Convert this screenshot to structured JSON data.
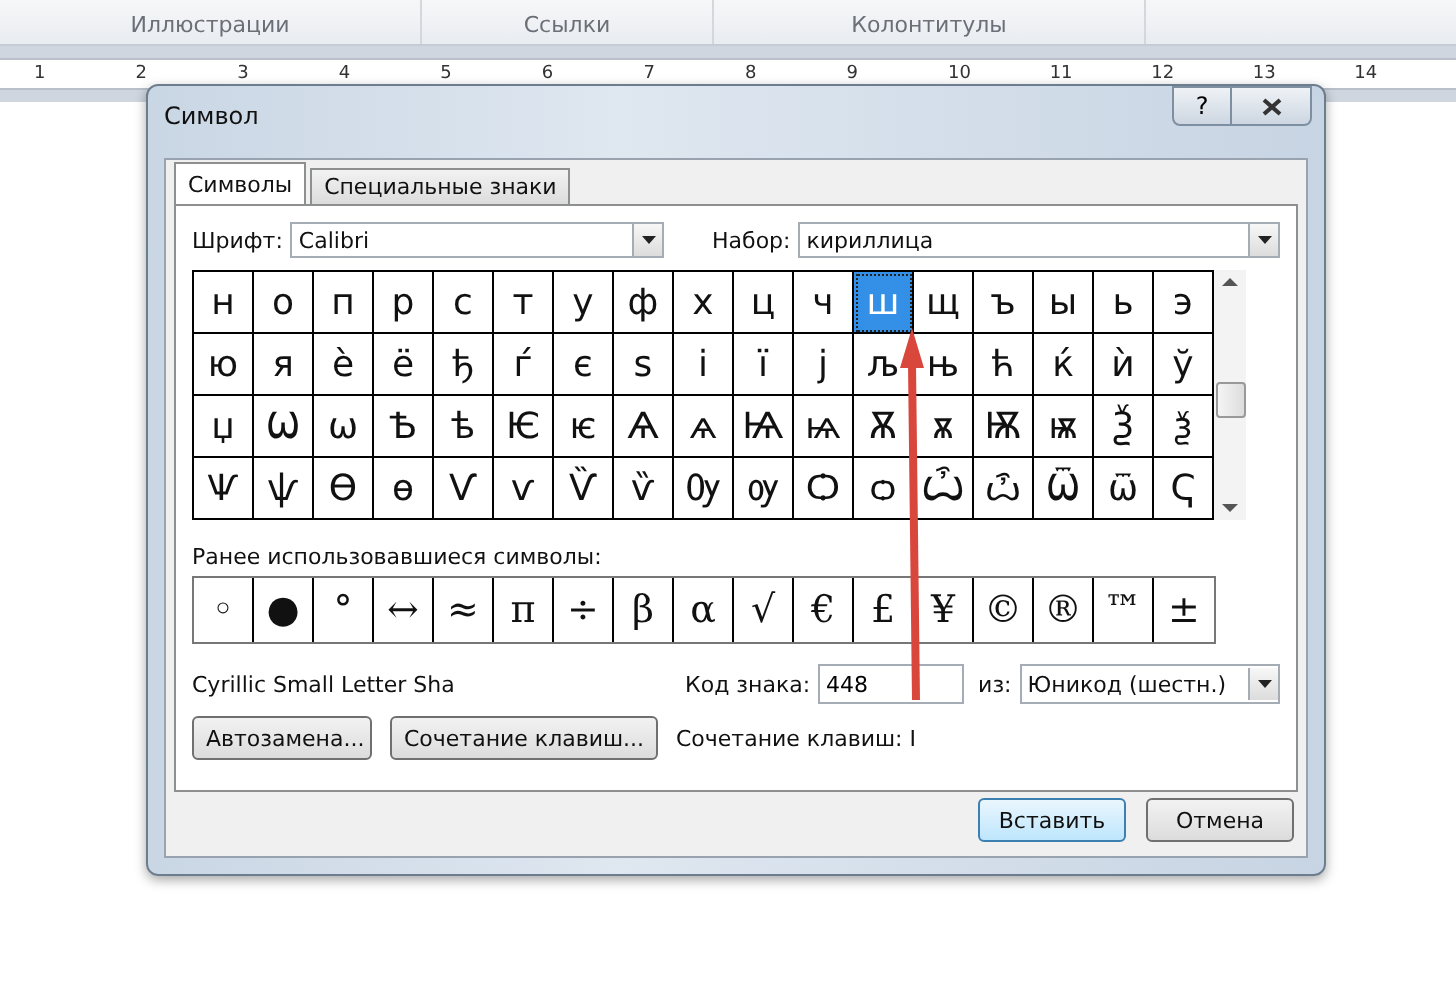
{
  "ribbon": {
    "groups": [
      "Иллюстрации",
      "Ссылки",
      "Колонтитулы"
    ]
  },
  "ruler": {
    "marks": [
      "1",
      "2",
      "3",
      "4",
      "5",
      "6",
      "7",
      "8",
      "9",
      "10",
      "11",
      "12",
      "13",
      "14"
    ]
  },
  "dialog": {
    "title": "Символ",
    "help_button": "?",
    "tabs": [
      {
        "label": "Символы",
        "selected": true
      },
      {
        "label": "Специальные знаки",
        "selected": false
      }
    ],
    "font": {
      "label": "Шрифт:",
      "value": "Calibri"
    },
    "subset": {
      "label": "Набор:",
      "value": "кириллица"
    },
    "symbols": [
      {
        "char": "н",
        "selected": false
      },
      {
        "char": "о",
        "selected": false
      },
      {
        "char": "п",
        "selected": false
      },
      {
        "char": "р",
        "selected": false
      },
      {
        "char": "с",
        "selected": false
      },
      {
        "char": "т",
        "selected": false
      },
      {
        "char": "у",
        "selected": false
      },
      {
        "char": "ф",
        "selected": false
      },
      {
        "char": "х",
        "selected": false
      },
      {
        "char": "ц",
        "selected": false
      },
      {
        "char": "ч",
        "selected": false
      },
      {
        "char": "ш",
        "selected": true
      },
      {
        "char": "щ",
        "selected": false
      },
      {
        "char": "ъ",
        "selected": false
      },
      {
        "char": "ы",
        "selected": false
      },
      {
        "char": "ь",
        "selected": false
      },
      {
        "char": "э",
        "selected": false
      },
      {
        "char": "ю",
        "selected": false
      },
      {
        "char": "я",
        "selected": false
      },
      {
        "char": "ѐ",
        "selected": false
      },
      {
        "char": "ё",
        "selected": false
      },
      {
        "char": "ђ",
        "selected": false
      },
      {
        "char": "ѓ",
        "selected": false
      },
      {
        "char": "є",
        "selected": false
      },
      {
        "char": "ѕ",
        "selected": false
      },
      {
        "char": "і",
        "selected": false
      },
      {
        "char": "ї",
        "selected": false
      },
      {
        "char": "ј",
        "selected": false
      },
      {
        "char": "љ",
        "selected": false
      },
      {
        "char": "њ",
        "selected": false
      },
      {
        "char": "ћ",
        "selected": false
      },
      {
        "char": "ќ",
        "selected": false
      },
      {
        "char": "ѝ",
        "selected": false
      },
      {
        "char": "ў",
        "selected": false
      },
      {
        "char": "џ",
        "selected": false
      },
      {
        "char": "Ѡ",
        "selected": false
      },
      {
        "char": "ѡ",
        "selected": false
      },
      {
        "char": "Ѣ",
        "selected": false
      },
      {
        "char": "ѣ",
        "selected": false
      },
      {
        "char": "Ѥ",
        "selected": false
      },
      {
        "char": "ѥ",
        "selected": false
      },
      {
        "char": "Ѧ",
        "selected": false
      },
      {
        "char": "ѧ",
        "selected": false
      },
      {
        "char": "Ѩ",
        "selected": false
      },
      {
        "char": "ѩ",
        "selected": false
      },
      {
        "char": "Ѫ",
        "selected": false
      },
      {
        "char": "ѫ",
        "selected": false
      },
      {
        "char": "Ѭ",
        "selected": false
      },
      {
        "char": "ѭ",
        "selected": false
      },
      {
        "char": "Ѯ",
        "selected": false
      },
      {
        "char": "ѯ",
        "selected": false
      },
      {
        "char": "Ѱ",
        "selected": false
      },
      {
        "char": "ѱ",
        "selected": false
      },
      {
        "char": "Ѳ",
        "selected": false
      },
      {
        "char": "ѳ",
        "selected": false
      },
      {
        "char": "Ѵ",
        "selected": false
      },
      {
        "char": "ѵ",
        "selected": false
      },
      {
        "char": "Ѷ",
        "selected": false
      },
      {
        "char": "ѷ",
        "selected": false
      },
      {
        "char": "Ѹ",
        "selected": false
      },
      {
        "char": "ѹ",
        "selected": false
      },
      {
        "char": "Ѻ",
        "selected": false
      },
      {
        "char": "ѻ",
        "selected": false
      },
      {
        "char": "Ѽ",
        "selected": false
      },
      {
        "char": "ѽ",
        "selected": false
      },
      {
        "char": "Ѿ",
        "selected": false
      },
      {
        "char": "ѿ",
        "selected": false
      },
      {
        "char": "Ҁ",
        "selected": false
      }
    ],
    "recent_label": "Ранее использовавшиеся символы:",
    "recent": [
      "◦",
      "●",
      "°",
      "↔",
      "≈",
      "π",
      "÷",
      "β",
      "α",
      "√",
      "€",
      "£",
      "¥",
      "©",
      "®",
      "™",
      "±"
    ],
    "char_name": "Cyrillic Small Letter Sha",
    "code": {
      "label": "Код знака:",
      "value": "448"
    },
    "from": {
      "label": "из:",
      "value": "Юникод (шестн.)"
    },
    "autocorrect_button": "Автозамена...",
    "shortcut_button": "Сочетание клавиш...",
    "shortcut_text": "Сочетание клавиш: I",
    "insert_button": "Вставить",
    "cancel_button": "Отмена"
  }
}
